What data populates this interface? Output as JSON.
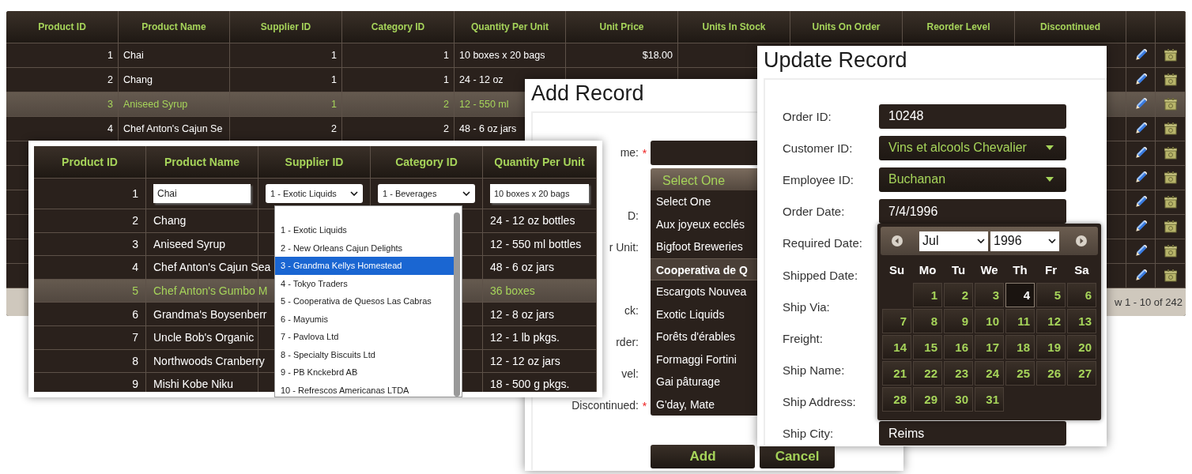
{
  "grid": {
    "columns": [
      {
        "label": "Product ID",
        "kind": "number"
      },
      {
        "label": "Product Name",
        "kind": "text"
      },
      {
        "label": "Supplier ID",
        "kind": "number"
      },
      {
        "label": "Category ID",
        "kind": "number"
      },
      {
        "label": "Quantity Per Unit",
        "kind": "text"
      },
      {
        "label": "Unit Price",
        "kind": "number"
      },
      {
        "label": "Units In Stock",
        "kind": "number"
      },
      {
        "label": "Units On Order",
        "kind": "number"
      },
      {
        "label": "Reorder Level",
        "kind": "number"
      },
      {
        "label": "Discontinued",
        "kind": "text"
      }
    ],
    "rows": [
      {
        "cells": [
          "1",
          "Chai",
          "1",
          "1",
          "10 boxes x 20 bags",
          "$18.00"
        ],
        "selected": false
      },
      {
        "cells": [
          "2",
          "Chang",
          "1",
          "1",
          "24 - 12 oz"
        ],
        "selected": false
      },
      {
        "cells": [
          "3",
          "Aniseed Syrup",
          "1",
          "2",
          "12 - 550 ml"
        ],
        "selected": true
      },
      {
        "cells": [
          "4",
          "Chef Anton's Cajun Se",
          "2",
          "2",
          "48 - 6 oz jars"
        ],
        "selected": false
      },
      {
        "selected": false
      },
      {
        "selected": false
      },
      {
        "selected": false
      },
      {
        "selected": false
      },
      {
        "selected": false
      },
      {
        "selected": false
      }
    ],
    "footer": "w 1 - 10 of 242"
  },
  "inline_editor": {
    "columns": [
      "Product ID",
      "Product Name",
      "Supplier ID",
      "Category ID",
      "Quantity Per Unit"
    ],
    "edit_row": {
      "id": "1",
      "name": "Chai",
      "supplier": "1 - Exotic Liquids",
      "category": "1 - Beverages",
      "quantity": "10 boxes x 20 bags"
    },
    "rows": [
      {
        "id": "2",
        "name": "Chang",
        "quantity": "24 - 12 oz bottles",
        "selected": false
      },
      {
        "id": "3",
        "name": "Aniseed Syrup",
        "quantity": "12 - 550 ml bottles",
        "selected": false
      },
      {
        "id": "4",
        "name": "Chef Anton's Cajun Sea",
        "quantity": "48 - 6 oz jars",
        "selected": false
      },
      {
        "id": "5",
        "name": "Chef Anton's Gumbo M",
        "quantity": "36 boxes",
        "selected": true
      },
      {
        "id": "6",
        "name": "Grandma's Boysenberr",
        "quantity": "12 - 8 oz jars",
        "selected": false
      },
      {
        "id": "7",
        "name": "Uncle Bob's Organic",
        "quantity": "12 - 1 lb pkgs.",
        "selected": false
      },
      {
        "id": "8",
        "name": "Northwoods Cranberry",
        "quantity": "12 - 12 oz jars",
        "selected": false
      },
      {
        "id": "9",
        "name": "Mishi Kobe Niku",
        "quantity": "18 - 500 g pkgs.",
        "selected": false
      }
    ],
    "supplier_options": [
      {
        "label": "1 - Exotic Liquids",
        "selected": false
      },
      {
        "label": "2 - New Orleans Cajun Delights",
        "selected": false
      },
      {
        "label": "3 - Grandma Kellys Homestead",
        "selected": true
      },
      {
        "label": "4 - Tokyo Traders",
        "selected": false
      },
      {
        "label": "5 - Cooperativa de Quesos Las Cabras",
        "selected": false
      },
      {
        "label": "6 - Mayumis",
        "selected": false
      },
      {
        "label": "7 - Pavlova Ltd",
        "selected": false
      },
      {
        "label": "8 - Specialty Biscuits Ltd",
        "selected": false
      },
      {
        "label": "9 - PB Knckebrd AB",
        "selected": false
      },
      {
        "label": "10 - Refrescos Americanas LTDA",
        "selected": false
      }
    ]
  },
  "add_record": {
    "title": "Add Record",
    "fields": [
      {
        "label": "me:",
        "required_mark": "*",
        "kind": "text"
      },
      {
        "kind": "select"
      },
      {
        "label": "D:"
      },
      {
        "label": "r Unit:"
      },
      {
        "kind": "text"
      },
      {
        "label": "ck:"
      },
      {
        "label": "rder:"
      },
      {
        "label": "vel:"
      },
      {
        "label": "Discontinued:",
        "required_mark": "*"
      }
    ],
    "supplier_list": {
      "value": "Select One",
      "options": [
        {
          "label": "Select One",
          "highlighted": false
        },
        {
          "label": "Aux joyeux ecclés",
          "highlighted": false
        },
        {
          "label": "Bigfoot Breweries",
          "highlighted": false
        },
        {
          "label": "Cooperativa de Q",
          "highlighted": true
        },
        {
          "label": "Escargots Nouvea",
          "highlighted": false
        },
        {
          "label": "Exotic Liquids",
          "highlighted": false
        },
        {
          "label": "Forêts d'érables",
          "highlighted": false
        },
        {
          "label": "Formaggi Fortini",
          "highlighted": false
        },
        {
          "label": "Gai pâturage",
          "highlighted": false
        },
        {
          "label": "G'day, Mate",
          "highlighted": false
        }
      ]
    },
    "buttons": [
      "Add",
      "Cancel"
    ]
  },
  "update_record": {
    "title": "Update Record",
    "fields": [
      {
        "label": "Order ID:",
        "kind": "text",
        "value": "10248"
      },
      {
        "label": "Customer ID:",
        "kind": "select",
        "value": "Vins et alcools Chevalier"
      },
      {
        "label": "Employee ID:",
        "kind": "select",
        "value": "Buchanan"
      },
      {
        "label": "Order Date:",
        "kind": "text",
        "value": "7/4/1996"
      },
      {
        "label": "Required Date:"
      },
      {
        "label": "Shipped Date:"
      },
      {
        "label": "Ship Via:"
      },
      {
        "label": "Freight:"
      },
      {
        "label": "Ship Name:"
      },
      {
        "label": "Ship Address:"
      },
      {
        "label": "Ship City:",
        "kind": "text",
        "value": "Reims"
      }
    ],
    "calendar": {
      "month": "Jul",
      "year": "1996",
      "weekdays": [
        "Su",
        "Mo",
        "Tu",
        "We",
        "Th",
        "Fr",
        "Sa"
      ],
      "weeks": [
        [
          {
            "label": "1",
            "selected": false
          },
          {
            "label": "2",
            "selected": false
          },
          {
            "label": "3",
            "selected": false
          },
          {
            "label": "4",
            "selected": true
          },
          {
            "label": "5",
            "selected": false
          },
          {
            "label": "6",
            "selected": false
          }
        ],
        [
          {
            "label": "7",
            "selected": false
          },
          {
            "label": "8",
            "selected": false
          },
          {
            "label": "9",
            "selected": false
          },
          {
            "label": "10",
            "selected": false
          },
          {
            "label": "11",
            "selected": false
          },
          {
            "label": "12",
            "selected": false
          },
          {
            "label": "13",
            "selected": false
          }
        ],
        [
          {
            "label": "14",
            "selected": false
          },
          {
            "label": "15",
            "selected": false
          },
          {
            "label": "16",
            "selected": false
          },
          {
            "label": "17",
            "selected": false
          },
          {
            "label": "18",
            "selected": false
          },
          {
            "label": "19",
            "selected": false
          },
          {
            "label": "20",
            "selected": false
          }
        ],
        [
          {
            "label": "21",
            "selected": false
          },
          {
            "label": "22",
            "selected": false
          },
          {
            "label": "23",
            "selected": false
          },
          {
            "label": "24",
            "selected": false
          },
          {
            "label": "25",
            "selected": false
          },
          {
            "label": "26",
            "selected": false
          },
          {
            "label": "27",
            "selected": false
          }
        ],
        [
          {
            "label": "28",
            "selected": false
          },
          {
            "label": "29",
            "selected": false
          },
          {
            "label": "30",
            "selected": false
          },
          {
            "label": "31",
            "selected": false
          }
        ]
      ]
    }
  }
}
